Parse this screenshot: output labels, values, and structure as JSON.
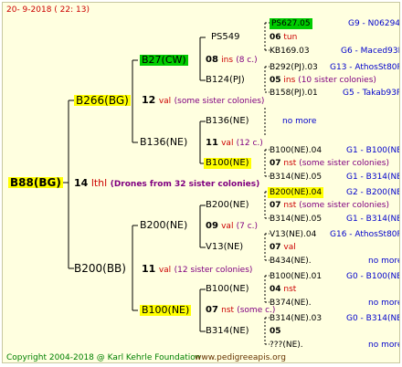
{
  "header": {
    "date": "20-  9-2018 (  22: 13)"
  },
  "footer": {
    "copyright": "Copyright 2004-2018 @ Karl Kehrle Foundation",
    "website": "www.pedigreeapis.org"
  },
  "root": {
    "name": "B88(BG)",
    "gen": "14",
    "code": "lthl",
    "note": "(Drones from 32 sister colonies)"
  },
  "g2": [
    {
      "name": "B266(BG)",
      "gen": "12",
      "code": "val",
      "note": "(some sister colonies)"
    },
    {
      "name": "B200(BB)",
      "gen": "11",
      "code": "val",
      "note": "(12 sister colonies)"
    }
  ],
  "g3": [
    {
      "name": "B27(CW)",
      "gen": "08",
      "code": "ins",
      "note": "(8 c.)"
    },
    {
      "name": "B136(NE)",
      "gen": "11",
      "code": "val",
      "note": "(12 c.)"
    },
    {
      "name": "B200(NE)",
      "gen": "09",
      "code": "val",
      "note": "(7 c.)"
    },
    {
      "name": "B100(NE)",
      "gen": "07",
      "code": "nst",
      "note": "(some c.)"
    }
  ],
  "g4": [
    {
      "name": "PS549"
    },
    {
      "name": "B124(PJ)",
      "gen": "05",
      "code": "ins",
      "note": "(10 sister colonies)"
    },
    {
      "name": "B136(NE)",
      "more": "no more"
    },
    {
      "name": "B100(NE)",
      "gen": "07",
      "code": "nst",
      "note": "(some sister colonies)"
    },
    {
      "name": "B200(NE)",
      "gen": "07",
      "code": "nst",
      "note": "(some sister colonies)"
    },
    {
      "name": "V13(NE)",
      "gen": "07",
      "code": "val"
    },
    {
      "name": "B100(NE)",
      "gen": "04",
      "code": "nst"
    },
    {
      "name": "B314(NE)",
      "gen": "05"
    }
  ],
  "g5": [
    {
      "name": "PS627.05",
      "line": "G9 - N06294R"
    },
    {
      "name": "KB169.03",
      "line": "G6 - Maced93R"
    },
    {
      "name": "B292(PJ).03",
      "line": "G13 - AthosSt80R"
    },
    {
      "name": "B158(PJ).01",
      "line": "G5 - Takab93R"
    },
    {
      "name": "B100(NE).04",
      "line": "G1 - B100(NE)"
    },
    {
      "name": "B314(NE).05",
      "line": "G1 - B314(NE)"
    },
    {
      "name": "B200(NE).04",
      "line": "G2 - B200(NE)"
    },
    {
      "name": "B314(NE).05",
      "line": "G1 - B314(NE)"
    },
    {
      "name": "V13(NE).04",
      "line": "G16 - AthosSt80R"
    },
    {
      "name": "B434(NE).",
      "more": "no more"
    },
    {
      "name": "B100(NE).01",
      "line": "G0 - B100(NE)"
    },
    {
      "name": "B374(NE).",
      "more": "no more"
    },
    {
      "name": "B314(NE).03",
      "line": "G0 - B314(NE)"
    },
    {
      "name": "???(NE).",
      "more": "no more"
    }
  ],
  "g4_extra": [
    {
      "gen": "06",
      "code": "tun"
    },
    {
      "more": "no more"
    }
  ]
}
